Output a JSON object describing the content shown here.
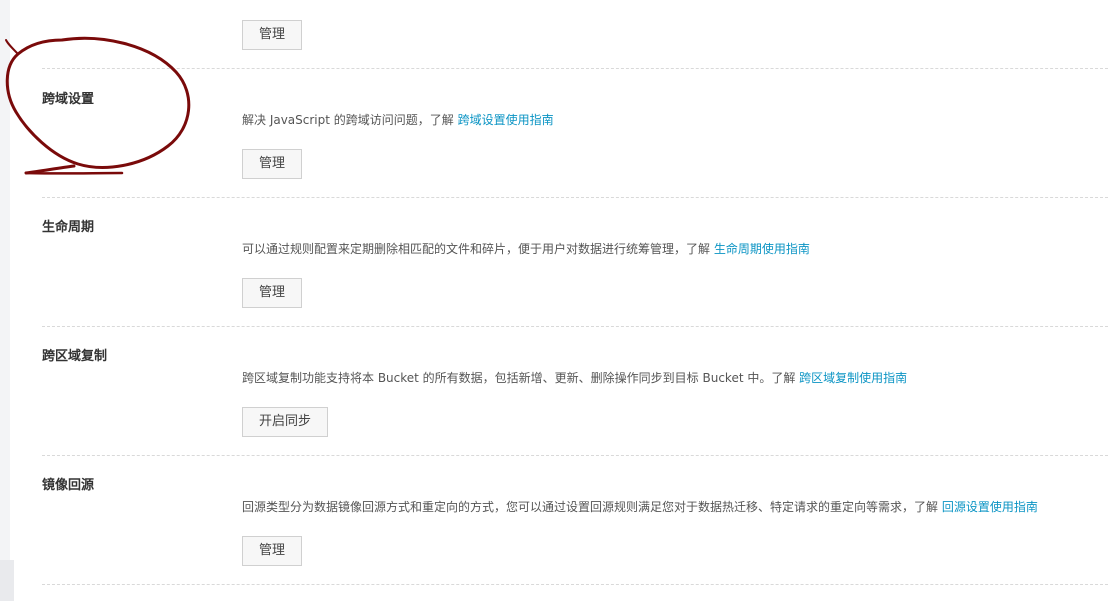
{
  "top": {
    "manage_label": "管理"
  },
  "sections": [
    {
      "title": "跨域设置",
      "desc_text": "解决 JavaScript 的跨域访问问题，了解 ",
      "link_text": "跨域设置使用指南",
      "button_label": "管理"
    },
    {
      "title": "生命周期",
      "desc_text": "可以通过规则配置来定期删除相匹配的文件和碎片，便于用户对数据进行统筹管理，了解 ",
      "link_text": "生命周期使用指南",
      "button_label": "管理"
    },
    {
      "title": "跨区域复制",
      "desc_text": "跨区域复制功能支持将本 Bucket 的所有数据，包括新增、更新、删除操作同步到目标 Bucket 中。了解 ",
      "link_text": "跨区域复制使用指南",
      "button_label": "开启同步"
    },
    {
      "title": "镜像回源",
      "desc_text": "回源类型分为数据镜像回源方式和重定向的方式，您可以通过设置回源规则满足您对于数据热迁移、特定请求的重定向等需求，了解 ",
      "link_text": "回源设置使用指南",
      "button_label": "管理"
    }
  ],
  "colors": {
    "link": "#0b94c4",
    "annotation_stroke": "#7a0a0a"
  }
}
